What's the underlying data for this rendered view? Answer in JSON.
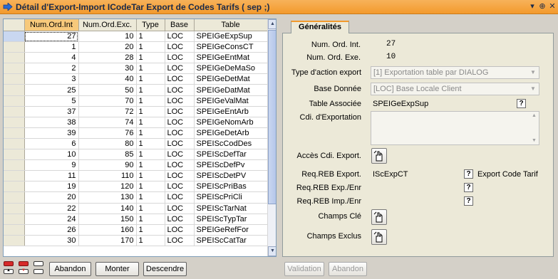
{
  "window": {
    "title": "Détail d'Export-Import ICodeTar Export de Codes Tarifs ( sep ;)",
    "buttons": [
      "▾",
      "⊕",
      "✕"
    ]
  },
  "grid": {
    "columns": [
      "Num.Ord.Int",
      "Num.Ord.Exc.",
      "Type",
      "Base",
      "Table"
    ],
    "rows": [
      {
        "int": "27",
        "exc": "10",
        "type": "1",
        "base": "LOC",
        "table": "SPEIGeExpSup"
      },
      {
        "int": "1",
        "exc": "20",
        "type": "1",
        "base": "LOC",
        "table": "SPEIGeConsCT"
      },
      {
        "int": "4",
        "exc": "28",
        "type": "1",
        "base": "LOC",
        "table": "SPEIGeEntMat"
      },
      {
        "int": "2",
        "exc": "30",
        "type": "1",
        "base": "LOC",
        "table": "SPEIGeDeMaSo"
      },
      {
        "int": "3",
        "exc": "40",
        "type": "1",
        "base": "LOC",
        "table": "SPEIGeDetMat"
      },
      {
        "int": "25",
        "exc": "50",
        "type": "1",
        "base": "LOC",
        "table": "SPEIGeDatMat"
      },
      {
        "int": "5",
        "exc": "70",
        "type": "1",
        "base": "LOC",
        "table": "SPEIGeValMat"
      },
      {
        "int": "37",
        "exc": "72",
        "type": "1",
        "base": "LOC",
        "table": "SPEIGeEntArb"
      },
      {
        "int": "38",
        "exc": "74",
        "type": "1",
        "base": "LOC",
        "table": "SPEIGeNomArb"
      },
      {
        "int": "39",
        "exc": "76",
        "type": "1",
        "base": "LOC",
        "table": "SPEIGeDetArb"
      },
      {
        "int": "6",
        "exc": "80",
        "type": "1",
        "base": "LOC",
        "table": "SPEIScCodDes"
      },
      {
        "int": "10",
        "exc": "85",
        "type": "1",
        "base": "LOC",
        "table": "SPEIScDefTar"
      },
      {
        "int": "9",
        "exc": "90",
        "type": "1",
        "base": "LOC",
        "table": "SPEIScDefPv"
      },
      {
        "int": "11",
        "exc": "110",
        "type": "1",
        "base": "LOC",
        "table": "SPEIScDetPV"
      },
      {
        "int": "19",
        "exc": "120",
        "type": "1",
        "base": "LOC",
        "table": "SPEIScPriBas"
      },
      {
        "int": "20",
        "exc": "130",
        "type": "1",
        "base": "LOC",
        "table": "SPEIScPriCli"
      },
      {
        "int": "22",
        "exc": "140",
        "type": "1",
        "base": "LOC",
        "table": "SPEIScTarNat"
      },
      {
        "int": "24",
        "exc": "150",
        "type": "1",
        "base": "LOC",
        "table": "SPEIScTypTar"
      },
      {
        "int": "26",
        "exc": "160",
        "type": "1",
        "base": "LOC",
        "table": "SPEIGeRefFor"
      },
      {
        "int": "30",
        "exc": "170",
        "type": "1",
        "base": "LOC",
        "table": "SPEIScCatTar"
      }
    ]
  },
  "left_buttons": {
    "abandon": "Abandon",
    "monter": "Monter",
    "descendre": "Descendre"
  },
  "tabs": [
    {
      "label": "Généralités"
    }
  ],
  "form": {
    "num_ord_int": {
      "label": "Num. Ord. Int.",
      "value": "27"
    },
    "num_ord_exe": {
      "label": "Num. Ord. Exe.",
      "value": "10"
    },
    "type_action": {
      "label": "Type d'action export",
      "value": "[1] Exportation table par DIALOG"
    },
    "base_donnee": {
      "label": "Base Donnée",
      "value": "[LOC] Base Locale Client"
    },
    "table_associee": {
      "label": "Table Associée",
      "value": "SPEIGeExpSup"
    },
    "cdi_exportation": {
      "label": "Cdi. d'Exportation",
      "value": ""
    },
    "acces_cdi": {
      "label": "Accès Cdi. Export."
    },
    "req_reb_export": {
      "label": "Req.REB Export.",
      "value": "IScExpCT",
      "desc": "Export Code Tarif e"
    },
    "req_reb_exp_enr": {
      "label": "Req.REB Exp./Enr"
    },
    "req_reb_imp_enr": {
      "label": "Req.REB Imp./Enr"
    },
    "champs_cle": {
      "label": "Champs Clé"
    },
    "champs_exclus": {
      "label": "Champs Exclus"
    },
    "help": "?"
  },
  "right_buttons": {
    "validation": "Validation",
    "abandon": "Abandon"
  },
  "colors": {
    "accent": "#f39a2c",
    "selection": "#f7c97b"
  }
}
